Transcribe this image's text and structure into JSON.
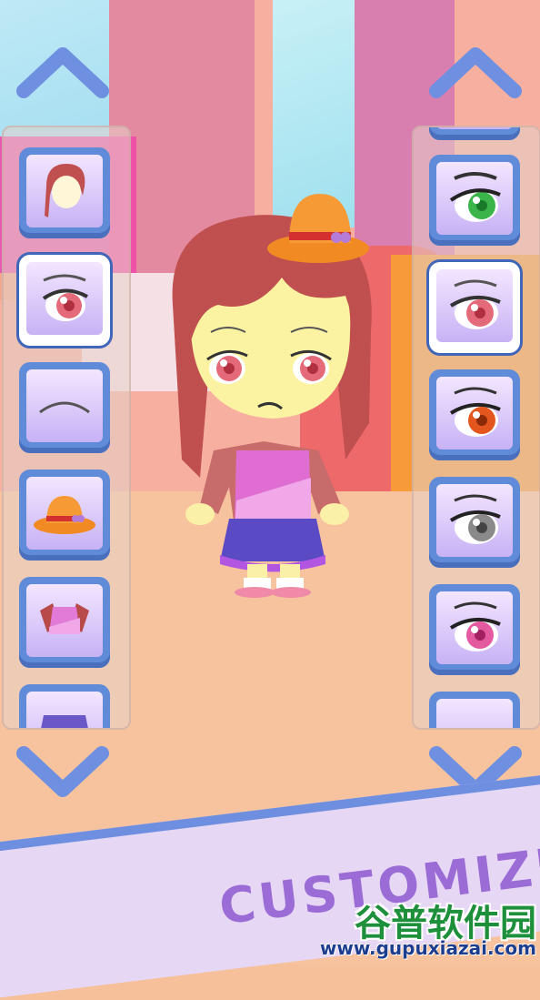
{
  "banner": {
    "text": "CUSTOMIZE!"
  },
  "watermark": {
    "title": "谷普软件园",
    "url": "www.gupuxiazai.com"
  },
  "left_panel": {
    "items": [
      {
        "name": "hair",
        "icon": "hair-icon",
        "selected": false
      },
      {
        "name": "eyes",
        "icon": "eyes-icon",
        "selected": true
      },
      {
        "name": "mouth",
        "icon": "mouth-icon",
        "selected": false
      },
      {
        "name": "hat",
        "icon": "hat-icon",
        "selected": false
      },
      {
        "name": "top",
        "icon": "top-icon",
        "selected": false
      },
      {
        "name": "bottom",
        "icon": "skirt-icon",
        "selected": false
      }
    ]
  },
  "right_panel": {
    "items": [
      {
        "name": "eye-option-green",
        "color": "#3bb54a",
        "selected": false
      },
      {
        "name": "eye-option-pink",
        "color": "#e46a7a",
        "selected": true
      },
      {
        "name": "eye-option-orange",
        "color": "#e5561e",
        "selected": false
      },
      {
        "name": "eye-option-gray",
        "color": "#8a8a8a",
        "selected": false
      },
      {
        "name": "eye-option-magenta",
        "color": "#e45aa0",
        "selected": false
      },
      {
        "name": "eye-option-partial",
        "color": "#888888",
        "selected": false
      }
    ]
  },
  "colors": {
    "arrow": "#6f8fe0",
    "tile": "#5f8bd8",
    "tile_inner": "#c7b2f5"
  }
}
